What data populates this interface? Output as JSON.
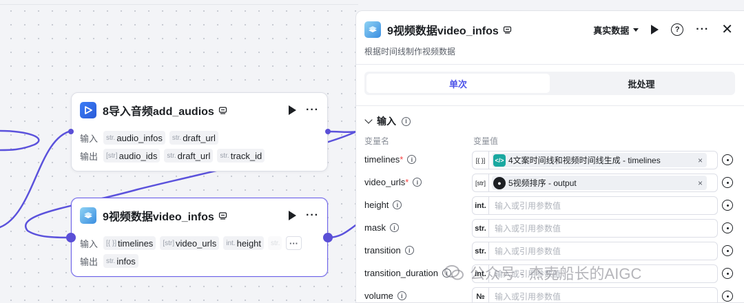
{
  "nodes": {
    "audio": {
      "title": "8导入音频add_audios",
      "input_label": "输入",
      "output_label": "输出",
      "inputs": [
        {
          "type": "str.",
          "name": "audio_infos"
        },
        {
          "type": "str.",
          "name": "draft_url"
        }
      ],
      "outputs": [
        {
          "type": "[str]",
          "name": "audio_ids"
        },
        {
          "type": "str.",
          "name": "draft_url"
        },
        {
          "type": "str.",
          "name": "track_id"
        }
      ]
    },
    "video": {
      "title": "9视频数据video_infos",
      "input_label": "输入",
      "output_label": "输出",
      "inputs": [
        {
          "type": "[{ }]",
          "name": "timelines"
        },
        {
          "type": "[str]",
          "name": "video_urls"
        },
        {
          "type": "int.",
          "name": "height"
        },
        {
          "type": "str.",
          "name": ""
        }
      ],
      "overflow": "···",
      "outputs": [
        {
          "type": "str.",
          "name": "infos"
        }
      ]
    }
  },
  "panel": {
    "title": "9视频数据video_infos",
    "subtitle": "根据时间线制作视频数据",
    "data_mode": "真实数据",
    "tabs": [
      {
        "label": "单次",
        "active": true
      },
      {
        "label": "批处理",
        "active": false
      }
    ],
    "section": "输入",
    "col_name": "变量名",
    "col_value": "变量值",
    "params": [
      {
        "name": "timelines",
        "required": true,
        "type": "[{ }]",
        "ref": "4文案时间线和视频时间线生成 - timelines",
        "ref_icon": "code-icon",
        "ref_color": "#1aa8a0"
      },
      {
        "name": "video_urls",
        "required": true,
        "type": "[str]",
        "ref": "5视频排序 - output",
        "ref_icon": "bot-icon",
        "ref_color": "#1c1f23"
      },
      {
        "name": "height",
        "required": false,
        "type": "int.",
        "placeholder": "输入或引用参数值"
      },
      {
        "name": "mask",
        "required": false,
        "type": "str.",
        "placeholder": "输入或引用参数值"
      },
      {
        "name": "transition",
        "required": false,
        "type": "str.",
        "placeholder": "输入或引用参数值"
      },
      {
        "name": "transition_duration",
        "required": false,
        "type": "int.",
        "placeholder": "输入或引用参数值"
      },
      {
        "name": "volume",
        "required": false,
        "type": "№",
        "placeholder": "输入或引用参数值"
      }
    ]
  },
  "watermark": "公众号 · 杰克船长的AIGC",
  "colors": {
    "accent": "#4d53e8",
    "port": "#5a4fd6",
    "edge": "#5b52dc"
  }
}
